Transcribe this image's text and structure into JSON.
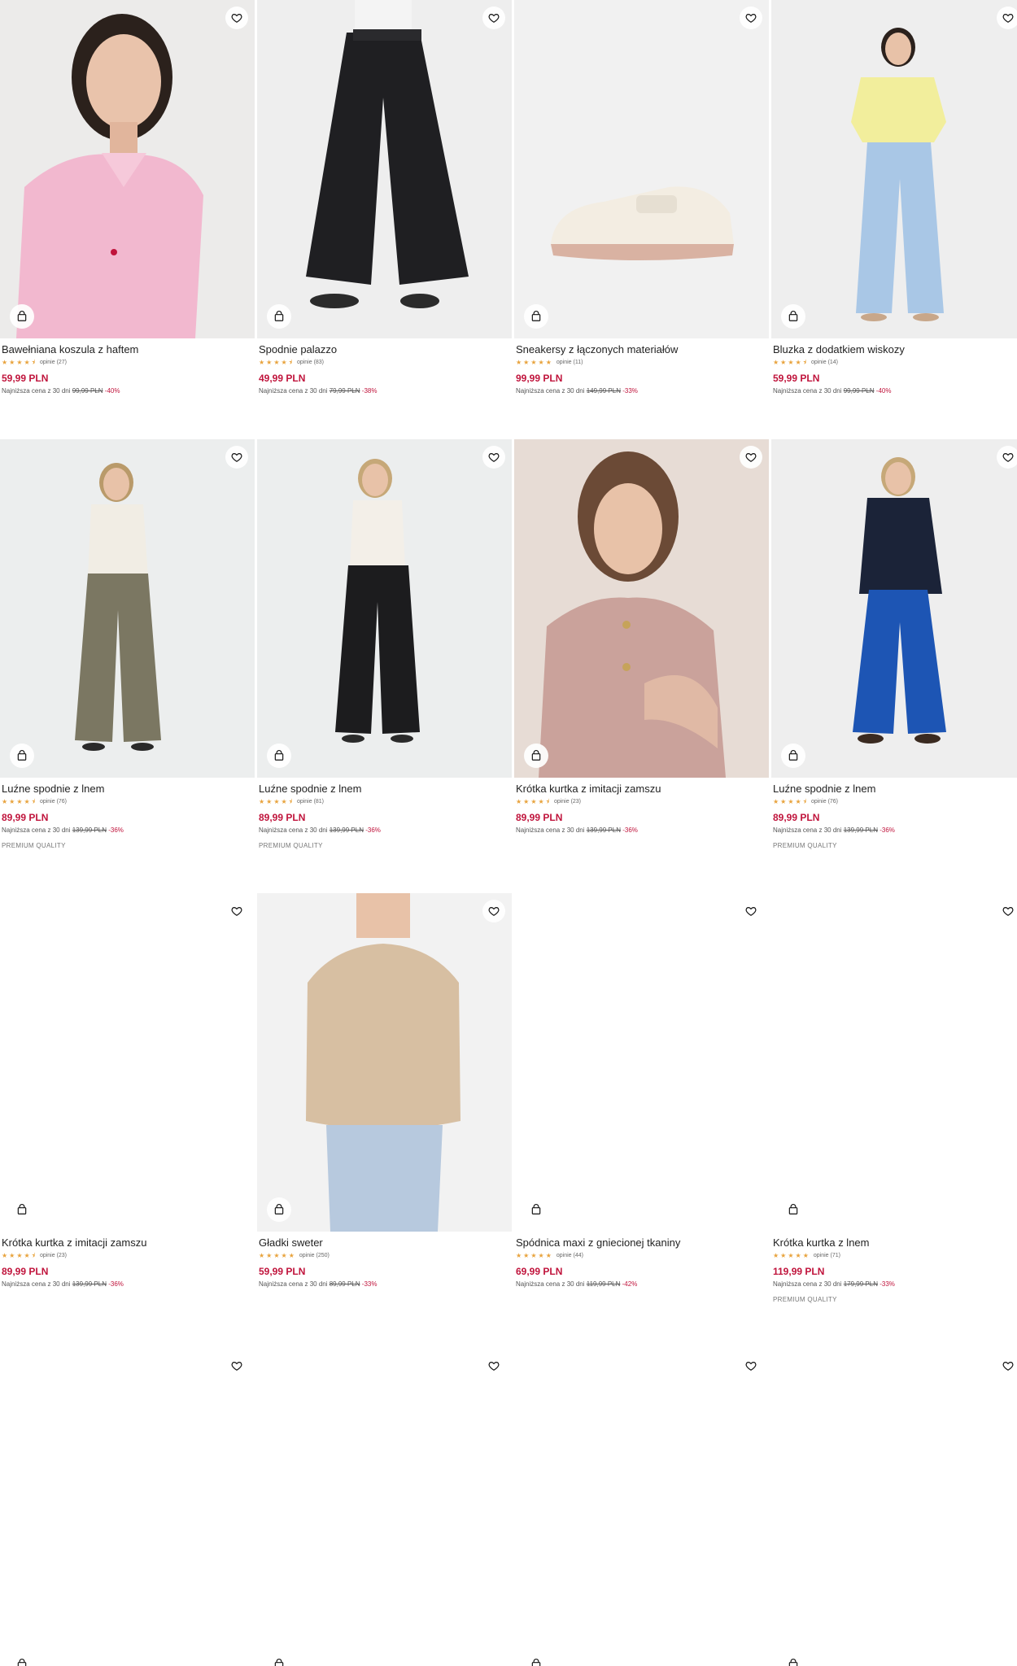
{
  "currency": "PLN",
  "colors": {
    "price": "#c0143c",
    "star": "#e8a33d"
  },
  "products": [
    {
      "name": "Bawełniana koszula z haftem",
      "rating": 4.5,
      "reviews": "opinie (27)",
      "price": "59,99 PLN",
      "lowest_prefix": "Najniższa cena z 30 dni",
      "old_price": "99,99 PLN",
      "discount": "-40%",
      "badge": "",
      "image": "pink-shirt-woman"
    },
    {
      "name": "Spodnie palazzo",
      "rating": 4.5,
      "reviews": "opinie (83)",
      "price": "49,99 PLN",
      "lowest_prefix": "Najniższa cena z 30 dni",
      "old_price": "79,99 PLN",
      "discount": "-38%",
      "badge": "",
      "image": "black-palazzo-pants"
    },
    {
      "name": "Sneakersy z łączonych materiałów",
      "rating": 5,
      "reviews": "opinie (11)",
      "price": "99,99 PLN",
      "lowest_prefix": "Najniższa cena z 30 dni",
      "old_price": "149,99 PLN",
      "discount": "-33%",
      "badge": "",
      "image": "cream-sneaker"
    },
    {
      "name": "Bluzka z dodatkiem wiskozy",
      "rating": 4.5,
      "reviews": "opinie (14)",
      "price": "59,99 PLN",
      "lowest_prefix": "Najniższa cena z 30 dni",
      "old_price": "99,99 PLN",
      "discount": "-40%",
      "badge": "",
      "image": "yellow-blouse-jeans"
    },
    {
      "name": "Luźne spodnie z lnem",
      "rating": 4.5,
      "reviews": "opinie (76)",
      "price": "89,99 PLN",
      "lowest_prefix": "Najniższa cena z 30 dni",
      "old_price": "139,99 PLN",
      "discount": "-36%",
      "badge": "PREMIUM QUALITY",
      "image": "olive-linen-pants"
    },
    {
      "name": "Luźne spodnie z lnem",
      "rating": 4.5,
      "reviews": "opinie (81)",
      "price": "89,99 PLN",
      "lowest_prefix": "Najniższa cena z 30 dni",
      "old_price": "139,99 PLN",
      "discount": "-36%",
      "badge": "PREMIUM QUALITY",
      "image": "black-linen-pants"
    },
    {
      "name": "Krótka kurtka z imitacji zamszu",
      "rating": 4.5,
      "reviews": "opinie (23)",
      "price": "89,99 PLN",
      "lowest_prefix": "Najniższa cena z 30 dni",
      "old_price": "139,99 PLN",
      "discount": "-36%",
      "badge": "",
      "image": "pink-suede-jacket"
    },
    {
      "name": "Luźne spodnie z lnem",
      "rating": 4.5,
      "reviews": "opinie (76)",
      "price": "89,99 PLN",
      "lowest_prefix": "Najniższa cena z 30 dni",
      "old_price": "139,99 PLN",
      "discount": "-36%",
      "badge": "PREMIUM QUALITY",
      "image": "blue-linen-pants"
    },
    {
      "name": "Krótka kurtka z imitacji zamszu",
      "rating": 4.5,
      "reviews": "opinie (23)",
      "price": "89,99 PLN",
      "lowest_prefix": "Najniższa cena z 30 dni",
      "old_price": "139,99 PLN",
      "discount": "-36%",
      "badge": "",
      "image": ""
    },
    {
      "name": "Gładki sweter",
      "rating": 5,
      "reviews": "opinie (250)",
      "price": "59,99 PLN",
      "lowest_prefix": "Najniższa cena z 30 dni",
      "old_price": "89,99 PLN",
      "discount": "-33%",
      "badge": "",
      "image": "beige-sweater"
    },
    {
      "name": "Spódnica maxi z gniecionej tkaniny",
      "rating": 5,
      "reviews": "opinie (44)",
      "price": "69,99 PLN",
      "lowest_prefix": "Najniższa cena z 30 dni",
      "old_price": "119,99 PLN",
      "discount": "-42%",
      "badge": "",
      "image": ""
    },
    {
      "name": "Krótka kurtka z lnem",
      "rating": 5,
      "reviews": "opinie (71)",
      "price": "119,99 PLN",
      "lowest_prefix": "Najniższa cena z 30 dni",
      "old_price": "179,99 PLN",
      "discount": "-33%",
      "badge": "PREMIUM QUALITY",
      "image": ""
    },
    {
      "name": "",
      "rating": 0,
      "reviews": "",
      "price": "",
      "lowest_prefix": "",
      "old_price": "",
      "discount": "",
      "badge": "",
      "image": ""
    },
    {
      "name": "",
      "rating": 0,
      "reviews": "",
      "price": "",
      "lowest_prefix": "",
      "old_price": "",
      "discount": "",
      "badge": "",
      "image": ""
    },
    {
      "name": "",
      "rating": 0,
      "reviews": "",
      "price": "",
      "lowest_prefix": "",
      "old_price": "",
      "discount": "",
      "badge": "",
      "image": ""
    },
    {
      "name": "",
      "rating": 0,
      "reviews": "",
      "price": "",
      "lowest_prefix": "",
      "old_price": "",
      "discount": "",
      "badge": "",
      "image": ""
    }
  ]
}
